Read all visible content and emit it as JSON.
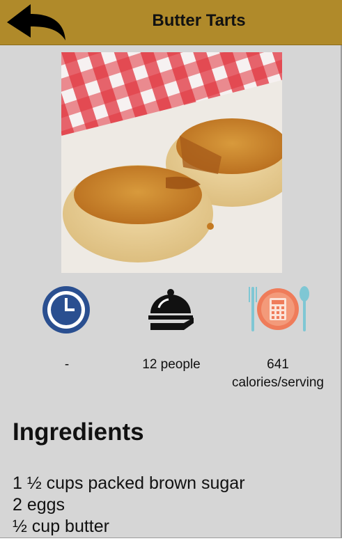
{
  "header": {
    "title": "Butter Tarts",
    "back_icon": "back-arrow-icon",
    "background": "#b08a2a"
  },
  "recipe": {
    "image_alt": "Butter Tarts",
    "time": {
      "icon": "clock-icon",
      "value": "-"
    },
    "servings": {
      "icon": "serving-cloche-icon",
      "value": "12 people"
    },
    "calories": {
      "icon": "calculator-plate-icon",
      "value": "641",
      "unit": "calories/serving"
    }
  },
  "ingredients": {
    "title": "Ingredients",
    "items": [
      "1 ½ cups packed brown sugar",
      "2 eggs",
      "½ cup butter"
    ]
  },
  "colors": {
    "panel": "#d6d6d6",
    "clock_blue": "#2a4f90",
    "calorie_orange": "#ef7c5a",
    "utensil_teal": "#7fc7d4"
  }
}
